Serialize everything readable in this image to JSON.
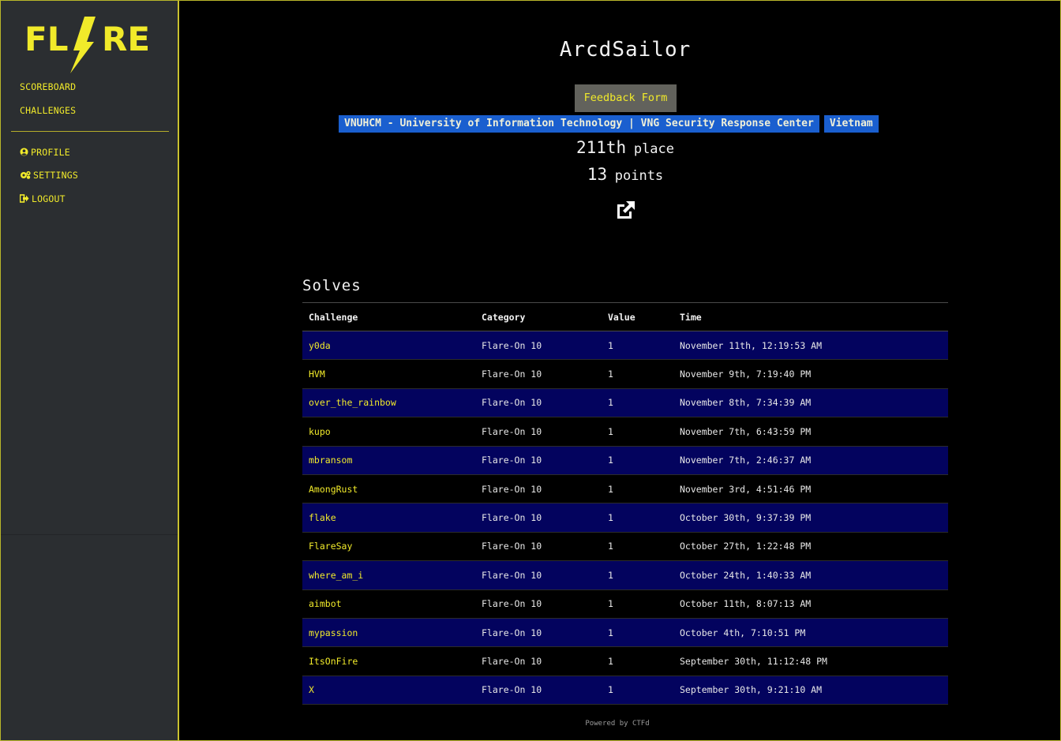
{
  "sidebar": {
    "logo_text": "FLARE",
    "nav": [
      {
        "label": "SCOREBOARD"
      },
      {
        "label": "CHALLENGES"
      }
    ],
    "user_nav": [
      {
        "label": "PROFILE",
        "icon": "user-circle-icon"
      },
      {
        "label": "SETTINGS",
        "icon": "cogs-icon"
      },
      {
        "label": "LOGOUT",
        "icon": "sign-out-icon"
      }
    ]
  },
  "profile": {
    "username": "ArcdSailor",
    "feedback_label": "Feedback Form",
    "affiliation": "VNUHCM - University of Information Technology | VNG Security Response Center",
    "country": "Vietnam",
    "place_value": "211th",
    "place_label": "place",
    "points_value": "13",
    "points_label": "points"
  },
  "solves": {
    "title": "Solves",
    "headers": [
      "Challenge",
      "Category",
      "Value",
      "Time"
    ],
    "rows": [
      [
        "y0da",
        "Flare-On 10",
        "1",
        "November 11th, 12:19:53 AM"
      ],
      [
        "HVM",
        "Flare-On 10",
        "1",
        "November 9th, 7:19:40 PM"
      ],
      [
        "over_the_rainbow",
        "Flare-On 10",
        "1",
        "November 8th, 7:34:39 AM"
      ],
      [
        "kupo",
        "Flare-On 10",
        "1",
        "November 7th, 6:43:59 PM"
      ],
      [
        "mbransom",
        "Flare-On 10",
        "1",
        "November 7th, 2:46:37 AM"
      ],
      [
        "AmongRust",
        "Flare-On 10",
        "1",
        "November 3rd, 4:51:46 PM"
      ],
      [
        "flake",
        "Flare-On 10",
        "1",
        "October 30th, 9:37:39 PM"
      ],
      [
        "FlareSay",
        "Flare-On 10",
        "1",
        "October 27th, 1:22:48 PM"
      ],
      [
        "where_am_i",
        "Flare-On 10",
        "1",
        "October 24th, 1:40:33 AM"
      ],
      [
        "aimbot",
        "Flare-On 10",
        "1",
        "October 11th, 8:07:13 AM"
      ],
      [
        "mypassion",
        "Flare-On 10",
        "1",
        "October 4th, 7:10:51 PM"
      ],
      [
        "ItsOnFire",
        "Flare-On 10",
        "1",
        "September 30th, 11:12:48 PM"
      ],
      [
        "X",
        "Flare-On 10",
        "1",
        "September 30th, 9:21:10 AM"
      ]
    ]
  },
  "footer": {
    "text": "Powered by CTFd"
  },
  "colors": {
    "accent": "#f1ea2a",
    "sidebar_bg": "#2b2e31",
    "row_alt": "#03035e",
    "badge": "#1a5fcf"
  }
}
